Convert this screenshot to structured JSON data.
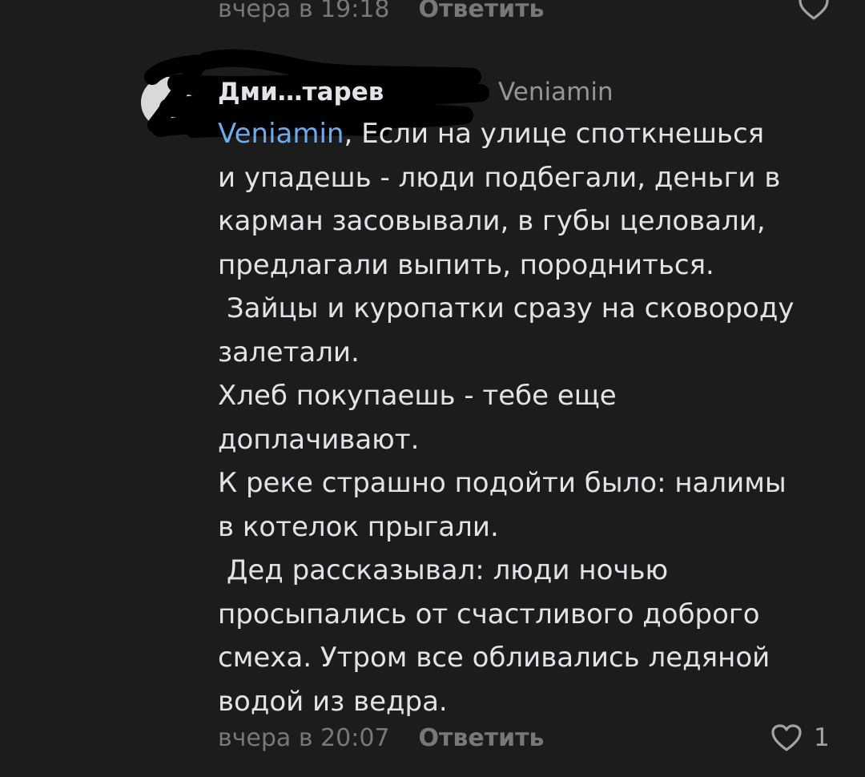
{
  "previous_comment": {
    "timestamp": "вчера в 19:18",
    "reply_label": "Ответить"
  },
  "comment": {
    "author": "Дми…тарев",
    "reply_to": "Veniamin",
    "mention": "Veniamin",
    "text_after_mention": ", Если на улице споткнешься\nи упадешь - люди подбегали, деньги в\nкарман засовывали, в губы целовали,\nпредлагали выпить, породниться.\n Зайцы и куропатки сразу на сковороду\nзалетали.\nХлеб покупаешь - тебе еще\nдоплачивают.\nК реке страшно подойти было: налимы\nв котелок прыгали.\n Дед рассказывал: люди ночью\nпросыпались от счастливого доброго\nсмеха. Утром все обливались ледяной\nводой из ведра.",
    "timestamp": "вчера в 20:07",
    "reply_label": "Ответить",
    "like_count": "1"
  },
  "icons": {
    "like": "heart-outline-icon",
    "avatar": "avatar"
  },
  "colors": {
    "background": "#1c1c1d",
    "text": "#e1e3e6",
    "mention": "#71aaeb",
    "secondary": "#76787a"
  }
}
